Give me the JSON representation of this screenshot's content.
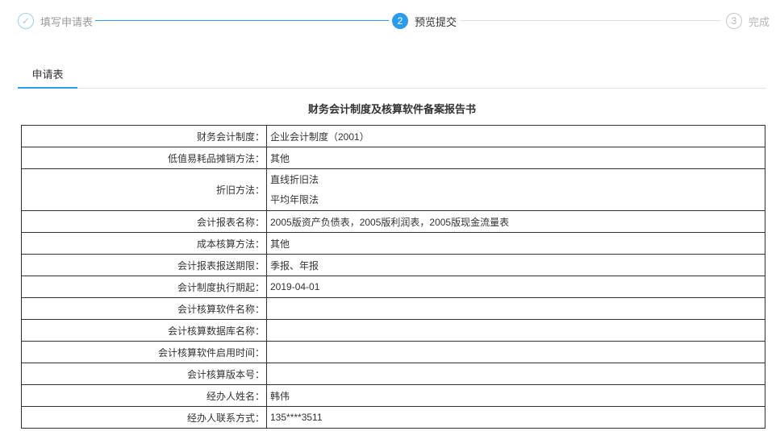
{
  "stepper": {
    "steps": [
      {
        "index": "✓",
        "label": "填写申请表",
        "state": "done"
      },
      {
        "index": "2",
        "label": "预览提交",
        "state": "active"
      },
      {
        "index": "3",
        "label": "完成",
        "state": "todo"
      }
    ]
  },
  "tab": {
    "label": "申请表"
  },
  "report": {
    "title": "财务会计制度及核算软件备案报告书",
    "rows": [
      {
        "label": "财务会计制度：",
        "value": "企业会计制度（2001）"
      },
      {
        "label": "低值易耗品摊销方法：",
        "value": "其他"
      },
      {
        "label": "折旧方法：",
        "values": [
          "直线折旧法",
          "平均年限法"
        ]
      },
      {
        "label": "会计报表名称：",
        "value": "2005版资产负债表，2005版利润表，2005版现金流量表"
      },
      {
        "label": "成本核算方法：",
        "value": "其他"
      },
      {
        "label": "会计报表报送期限：",
        "value": "季报、年报"
      },
      {
        "label": "会计制度执行期起：",
        "value": "2019-04-01"
      },
      {
        "label": "会计核算软件名称：",
        "value": ""
      },
      {
        "label": "会计核算数据库名称：",
        "value": ""
      },
      {
        "label": "会计核算软件启用时间：",
        "value": ""
      },
      {
        "label": "会计核算版本号：",
        "value": ""
      },
      {
        "label": "经办人姓名：",
        "value": "韩伟"
      },
      {
        "label": "经办人联系方式：",
        "value": "135****3511"
      }
    ]
  }
}
